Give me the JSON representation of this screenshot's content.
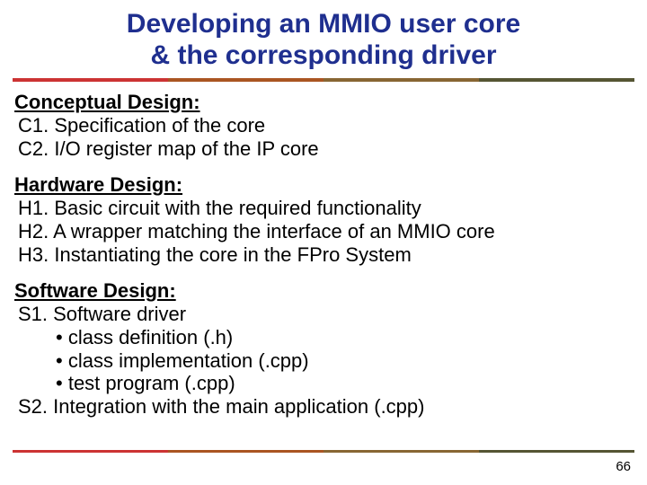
{
  "title_line1": "Developing an MMIO user core",
  "title_line2": "& the corresponding driver",
  "sections": {
    "conceptual": {
      "heading": "Conceptual Design:",
      "c1": "C1. Specification of the core",
      "c2": "C2. I/O register map of the IP core"
    },
    "hardware": {
      "heading": "Hardware Design:",
      "h1": "H1. Basic circuit with the required functionality",
      "h2": "H2. A wrapper matching the interface of an MMIO core",
      "h3": "H3. Instantiating the core in the FPro System"
    },
    "software": {
      "heading": "Software Design:",
      "s1": "S1. Software driver",
      "s1a": "class definition (.h)",
      "s1b": "class implementation (.cpp)",
      "s1c": "test program (.cpp)",
      "s2": "S2. Integration with the main application (.cpp)"
    }
  },
  "page_number": "66"
}
